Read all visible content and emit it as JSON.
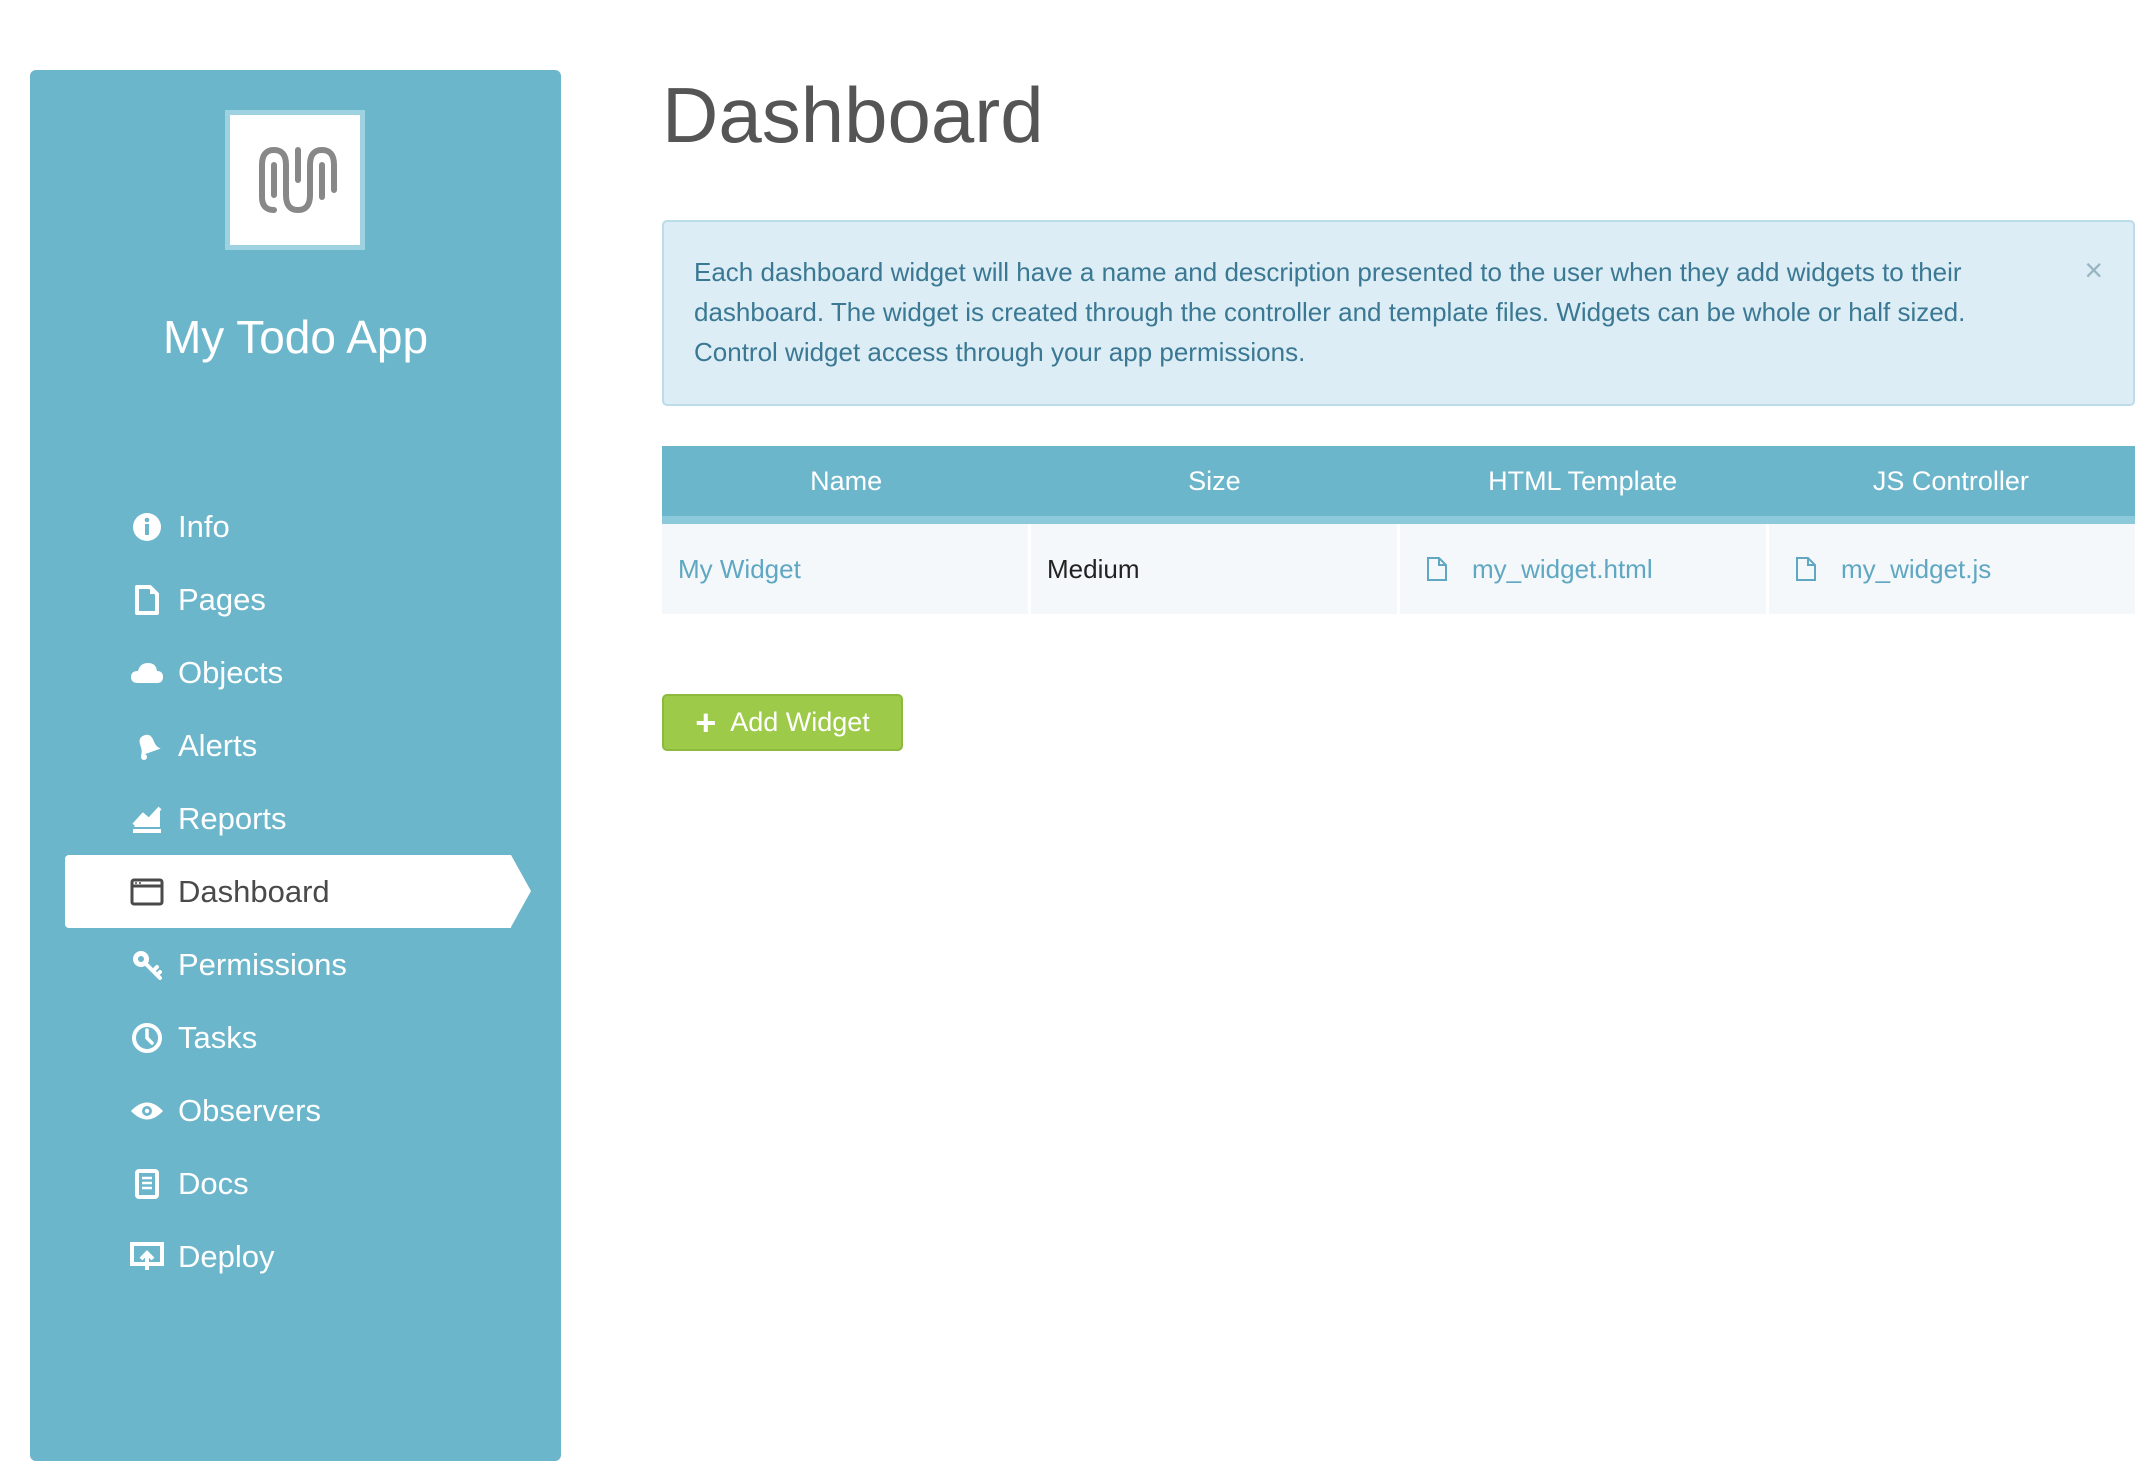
{
  "app": {
    "title": "My Todo App"
  },
  "sidebar": {
    "items": [
      {
        "label": "Info",
        "icon": "info-icon"
      },
      {
        "label": "Pages",
        "icon": "page-icon"
      },
      {
        "label": "Objects",
        "icon": "cloud-icon"
      },
      {
        "label": "Alerts",
        "icon": "bell-icon"
      },
      {
        "label": "Reports",
        "icon": "chart-icon"
      },
      {
        "label": "Dashboard",
        "icon": "dashboard-icon",
        "active": true
      },
      {
        "label": "Permissions",
        "icon": "key-icon"
      },
      {
        "label": "Tasks",
        "icon": "clock-icon"
      },
      {
        "label": "Observers",
        "icon": "eye-icon"
      },
      {
        "label": "Docs",
        "icon": "doc-icon"
      },
      {
        "label": "Deploy",
        "icon": "deploy-icon"
      }
    ]
  },
  "main": {
    "title": "Dashboard",
    "alert": {
      "text": "Each dashboard widget will have a name and description presented to the user when they add widgets to their dashboard. The widget is created through the controller and template files. Widgets can be whole or half sized. Control widget access through your app permissions.",
      "close": "×"
    },
    "table": {
      "headers": [
        "Name",
        "Size",
        "HTML Template",
        "JS Controller"
      ],
      "rows": [
        {
          "name": "My Widget",
          "size": "Medium",
          "template": "my_widget.html",
          "controller": "my_widget.js"
        }
      ]
    },
    "add_button": "Add Widget"
  },
  "colors": {
    "sidebar": "#6cb6cc",
    "alert_bg": "#dcedf5",
    "button": "#9dca49",
    "link": "#5fa7c2"
  }
}
